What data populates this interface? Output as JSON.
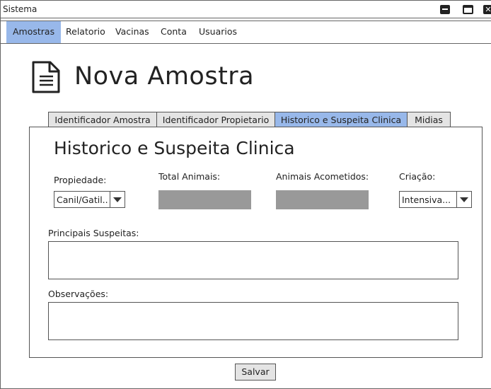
{
  "window": {
    "title": "Sistema"
  },
  "menu": {
    "items": [
      {
        "label": "Amostras",
        "active": true
      },
      {
        "label": "Relatorio"
      },
      {
        "label": "Vacinas"
      },
      {
        "label": "Conta"
      },
      {
        "label": "Usuarios"
      }
    ]
  },
  "page": {
    "title": "Nova Amostra"
  },
  "tabs": [
    {
      "label": "Identificador Amostra"
    },
    {
      "label": "Identificador Propietario"
    },
    {
      "label": "Historico e Suspeita Clinica",
      "active": true
    },
    {
      "label": "Midias"
    }
  ],
  "form": {
    "section_title": "Historico e Suspeita Clinica",
    "propiedade": {
      "label": "Propiedade:",
      "value": "Canil/Gatil.."
    },
    "total_animais": {
      "label": "Total Animais:",
      "value": ""
    },
    "animais_acometidos": {
      "label": "Animais Acometidos:",
      "value": ""
    },
    "criacao": {
      "label": "Criação:",
      "value": "Intensiva..."
    },
    "principais_suspeitas": {
      "label": "Principais Suspeitas:",
      "value": ""
    },
    "observacoes": {
      "label": "Observações:",
      "value": ""
    },
    "save_label": "Salvar"
  },
  "colors": {
    "accent": "#98b8ea",
    "field_gray": "#999999",
    "tab_gray": "#e4e4e4"
  },
  "icons": [
    "minimize-icon",
    "maximize-icon",
    "close-icon",
    "document-icon",
    "chevron-down-icon"
  ]
}
